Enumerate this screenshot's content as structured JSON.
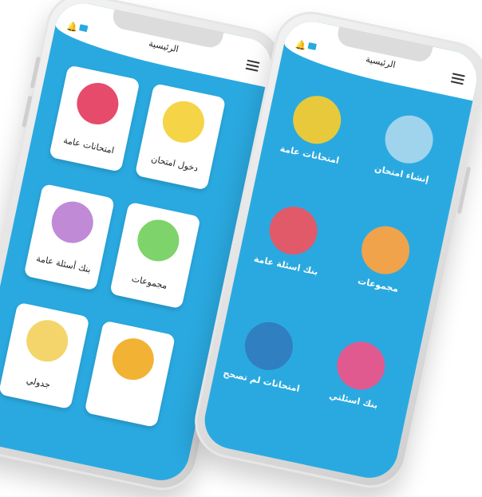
{
  "phone_left": {
    "header_title": "الرئيسية",
    "cards": [
      {
        "label": "امتحانات عامة",
        "icon": "exam-paper-icon",
        "color": "#e64b6c"
      },
      {
        "label": "دخول امتحان",
        "icon": "whiteboard-icon",
        "color": "#f5d547"
      },
      {
        "label": "بنك أسئلة عامة",
        "icon": "question-list-icon",
        "color": "#c08ad6"
      },
      {
        "label": "مجموعات",
        "icon": "group-icon",
        "color": "#7ed36b"
      },
      {
        "label": "جدولي",
        "icon": "calendar-icon",
        "color": "#f3d56b"
      },
      {
        "label": "",
        "icon": "medal-icon",
        "color": "#f2b233"
      }
    ]
  },
  "phone_right": {
    "header_title": "الرئيسية",
    "items": [
      {
        "label": "امتحانات عامة",
        "icon": "question-marks-icon",
        "color": "#e8c93c"
      },
      {
        "label": "إنشاء امتحان",
        "icon": "create-exam-icon",
        "color": "#9fd4ec"
      },
      {
        "label": "بنك اسئلة عامة",
        "icon": "question-list-icon",
        "color": "#e05a6a"
      },
      {
        "label": "مجموعات",
        "icon": "group-icon",
        "color": "#f0a34a"
      },
      {
        "label": "امتحانات لم تصحح",
        "icon": "checklist-icon",
        "color": "#2f7fc1"
      },
      {
        "label": "بنك اسئلتي",
        "icon": "qa-icon",
        "color": "#e05a8f"
      }
    ]
  },
  "colors": {
    "screen": "#2aa9e0",
    "card": "#ffffff"
  }
}
